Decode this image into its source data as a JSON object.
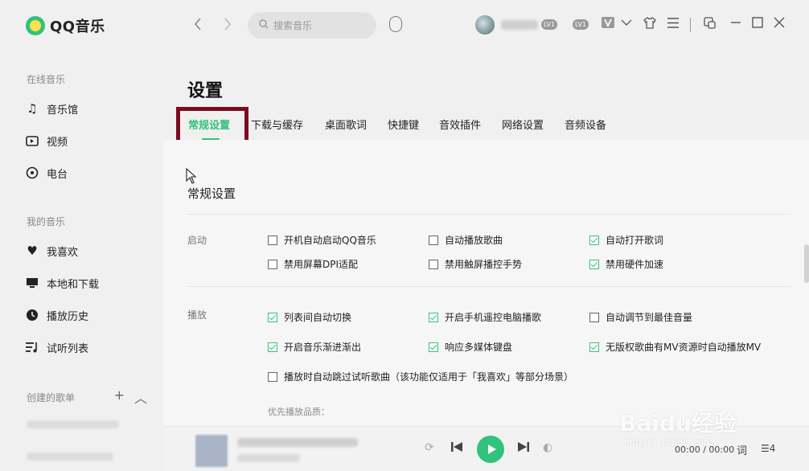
{
  "app": {
    "name": "QQ音乐"
  },
  "sidebar": {
    "sections": {
      "online": "在线音乐",
      "mine": "我的音乐",
      "created": "创建的歌单"
    },
    "online_items": [
      {
        "label": "音乐馆",
        "icon": "music-note-icon"
      },
      {
        "label": "视频",
        "icon": "video-icon"
      },
      {
        "label": "电台",
        "icon": "radio-icon"
      }
    ],
    "my_items": [
      {
        "label": "我喜欢",
        "icon": "heart-icon"
      },
      {
        "label": "本地和下载",
        "icon": "monitor-icon"
      },
      {
        "label": "播放历史",
        "icon": "history-icon"
      },
      {
        "label": "试听列表",
        "icon": "playlist-icon"
      }
    ]
  },
  "topbar": {
    "search_placeholder": "搜索音乐",
    "badges": [
      "LV1",
      "LV1"
    ]
  },
  "settings": {
    "title": "设置",
    "tabs": [
      "常规设置",
      "下载与缓存",
      "桌面歌词",
      "快捷键",
      "音效插件",
      "网络设置",
      "音频设备"
    ],
    "active_tab": 0,
    "section_title": "常规设置",
    "groups": {
      "startup": {
        "label": "启动",
        "options": [
          {
            "label": "开机自动启动QQ音乐",
            "checked": false
          },
          {
            "label": "自动播放歌曲",
            "checked": false
          },
          {
            "label": "自动打开歌词",
            "checked": true
          },
          {
            "label": "禁用屏幕DPI适配",
            "checked": false
          },
          {
            "label": "禁用触屏播控手势",
            "checked": false
          },
          {
            "label": "禁用硬件加速",
            "checked": true
          }
        ]
      },
      "playback": {
        "label": "播放",
        "options": [
          {
            "label": "列表间自动切换",
            "checked": true
          },
          {
            "label": "开启手机遥控电脑播歌",
            "checked": true
          },
          {
            "label": "自动调节到最佳音量",
            "checked": false
          },
          {
            "label": "开启音乐渐进渐出",
            "checked": true
          },
          {
            "label": "响应多媒体键盘",
            "checked": true
          },
          {
            "label": "无版权歌曲有MV资源时自动播放MV",
            "checked": true
          },
          {
            "label": "播放时自动跳过试听歌曲（该功能仅适用于「我喜欢」等部分场景）",
            "checked": false
          }
        ],
        "quality_label": "优先播放品质："
      }
    }
  },
  "player": {
    "time": "00:00 / 00:00",
    "lyric": "词",
    "queue_count": "4"
  },
  "watermark": {
    "main": "Baidu经验",
    "sub": "jingyan.baidu.com"
  },
  "colors": {
    "accent": "#31c27c",
    "highlight": "#7a0c1f"
  }
}
